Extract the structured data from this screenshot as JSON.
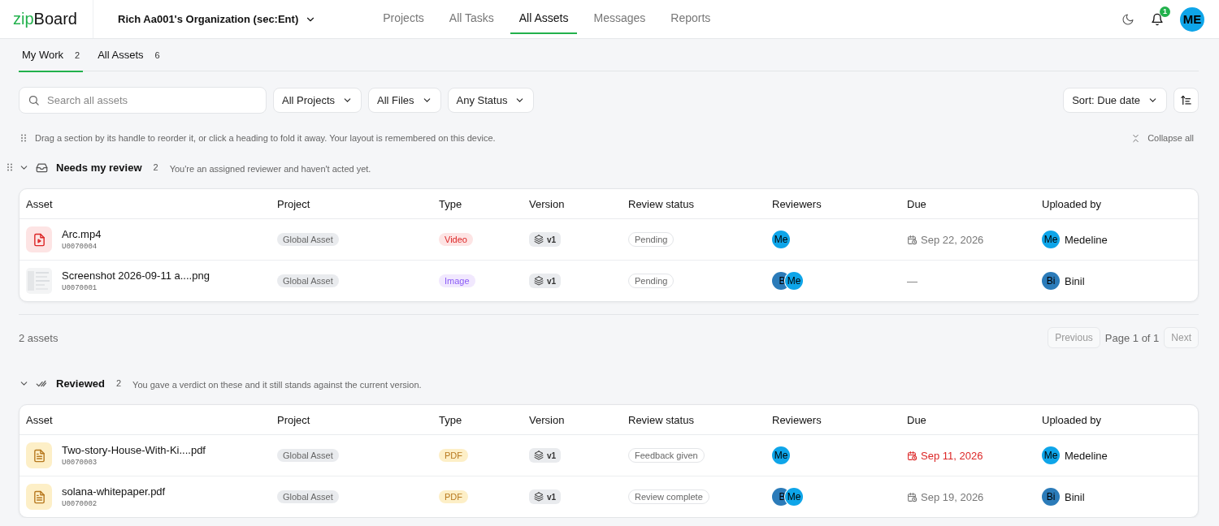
{
  "header": {
    "logo": {
      "prefix": "zip",
      "suffix": "Board"
    },
    "organization": "Rich Aa001's Organization (sec:Ent)",
    "nav": [
      {
        "label": "Projects",
        "selected": false
      },
      {
        "label": "All Tasks",
        "selected": false
      },
      {
        "label": "All Assets",
        "selected": true
      },
      {
        "label": "Messages",
        "selected": false
      },
      {
        "label": "Reports",
        "selected": false
      }
    ],
    "notifications": "1",
    "user": {
      "initials": "ME",
      "color": "#0ea5e9"
    }
  },
  "tabs": [
    {
      "label": "My Work",
      "count": "2",
      "selected": true
    },
    {
      "label": "All Assets",
      "count": "6",
      "selected": false
    }
  ],
  "filters": {
    "search": {
      "placeholder": "Search all assets"
    },
    "dropdowns": [
      "All Projects",
      "All Files",
      "Any Status"
    ],
    "sort": "Sort: Due date"
  },
  "hint": "Drag a section by its handle to reorder it, or click a heading to fold it away. Your layout is remembered on this device.",
  "collapse_all": "Collapse all",
  "sections": [
    {
      "title": "Needs my review",
      "count": "2",
      "description": "You're an assigned reviewer and haven't acted yet.",
      "expanded": true,
      "handle": true,
      "columns": [
        "Asset",
        "Project",
        "Type",
        "Version",
        "Review status",
        "Reviewers",
        "Due",
        "Uploaded by"
      ],
      "rows": [
        {
          "name": "Arc.mp4",
          "id": "U0070004",
          "kind": "video",
          "project": "Global Asset",
          "type": "Video",
          "version": "v1",
          "status": "Pending",
          "reviewers": [
            {
              "initials": "Me",
              "color": "#0ea5e9"
            }
          ],
          "due": "Sep 22, 2026",
          "overdue": false,
          "uploader": {
            "initials": "Me",
            "name": "Medeline",
            "color": "#0ea5e9"
          }
        },
        {
          "name": "Screenshot 2026-09-11 a....png",
          "id": "U0070001",
          "project": "Global Asset",
          "type": "Image",
          "version": "v1",
          "status": "Pending",
          "reviewers": [
            {
              "initials": "B",
              "color": "#2b7bb9"
            },
            {
              "initials": "Me",
              "color": "#0ea5e9"
            }
          ],
          "due": "—",
          "overdue": false,
          "uploader": {
            "initials": "Bi",
            "name": "Binil",
            "color": "#2b7bb9"
          }
        }
      ],
      "footer": {
        "total": "2 assets",
        "previous": {
          "label": "Previous",
          "disabled": true
        },
        "page": "Page 1 of 1",
        "next": {
          "label": "Next",
          "disabled": true
        }
      }
    },
    {
      "title": "Reviewed",
      "count": "2",
      "description": "You gave a verdict on these and it still stands against the current version.",
      "expanded": true,
      "handle": false,
      "columns": [
        "Asset",
        "Project",
        "Type",
        "Version",
        "Review status",
        "Reviewers",
        "Due",
        "Uploaded by"
      ],
      "rows": [
        {
          "name": "Two-story-House-With-Ki....pdf",
          "id": "U0070003",
          "kind": "pdf",
          "project": "Global Asset",
          "type": "PDF",
          "version": "v1",
          "status": "Feedback given",
          "reviewers": [
            {
              "initials": "Me",
              "color": "#0ea5e9"
            }
          ],
          "due": "Sep 11, 2026",
          "overdue": true,
          "uploader": {
            "initials": "Me",
            "name": "Medeline",
            "color": "#0ea5e9"
          }
        },
        {
          "name": "solana-whitepaper.pdf",
          "id": "U0070002",
          "kind": "pdf",
          "project": "Global Asset",
          "type": "PDF",
          "version": "v1",
          "status": "Review complete",
          "reviewers": [
            {
              "initials": "B",
              "color": "#2b7bb9"
            },
            {
              "initials": "Me",
              "color": "#0ea5e9"
            }
          ],
          "due": "Sep 19, 2026",
          "overdue": false,
          "uploader": {
            "initials": "Bi",
            "name": "Binil",
            "color": "#2b7bb9"
          }
        }
      ]
    }
  ]
}
